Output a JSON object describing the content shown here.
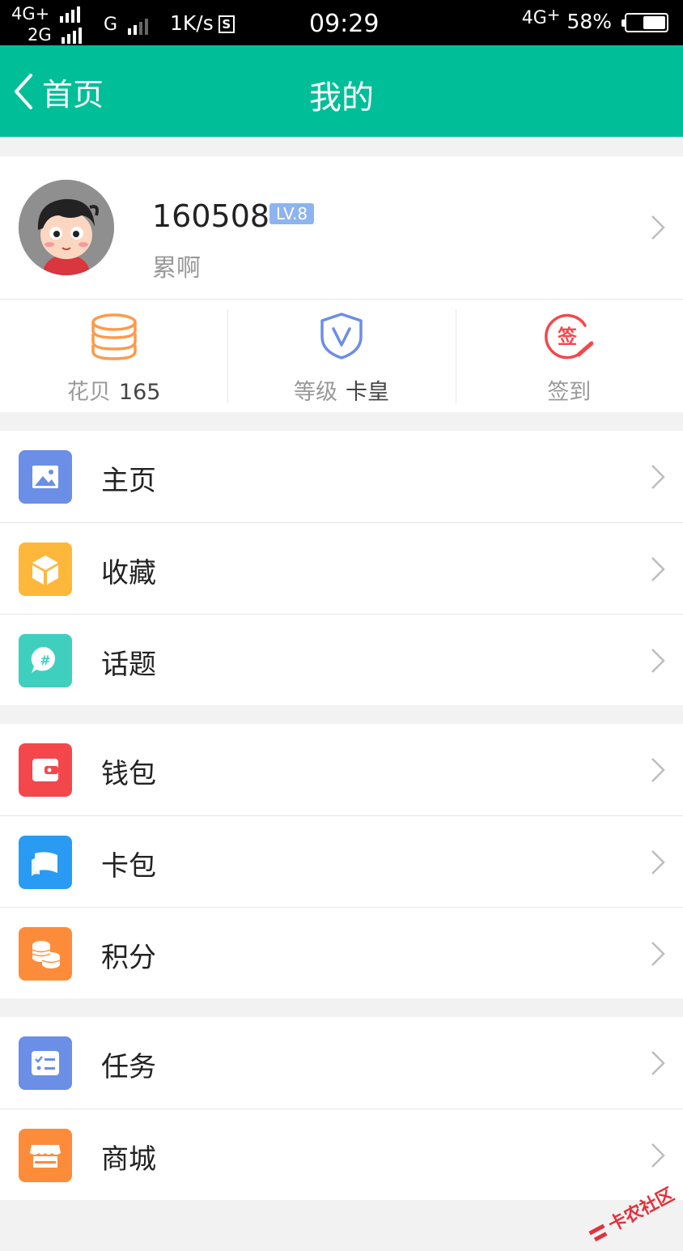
{
  "status_bar": {
    "net1": "4G+",
    "net2": "2G",
    "net3": "G",
    "speed": "1K/s",
    "sim_icon": "S",
    "time": "09:29",
    "net4": "4G",
    "battery": "58%",
    "battery_level": 0.58
  },
  "header": {
    "back_label": "首页",
    "title": "我的",
    "color": "#00bf98"
  },
  "profile": {
    "username": "160508",
    "level_badge": "LV.8",
    "signature": "累啊"
  },
  "stats": [
    {
      "label": "花贝",
      "value": "165",
      "icon": "coins-stack-icon"
    },
    {
      "label": "等级",
      "value": "卡皇",
      "icon": "shield-v-icon"
    },
    {
      "label": "签到",
      "value": "",
      "icon": "checkin-stamp-icon"
    }
  ],
  "menu": {
    "group1": [
      {
        "label": "主页",
        "icon": "image-icon",
        "color": "#6b8ee6"
      },
      {
        "label": "收藏",
        "icon": "box-icon",
        "color": "#fdb73a"
      },
      {
        "label": "话题",
        "icon": "hashtag-chat-icon",
        "color": "#3fcfbf"
      }
    ],
    "group2": [
      {
        "label": "钱包",
        "icon": "wallet-icon",
        "color": "#f4474c"
      },
      {
        "label": "卡包",
        "icon": "card-icon",
        "color": "#2a9bf2"
      },
      {
        "label": "积分",
        "icon": "coins-icon",
        "color": "#fd8c3a"
      }
    ],
    "group3": [
      {
        "label": "任务",
        "icon": "task-list-icon",
        "color": "#6b8ee6"
      },
      {
        "label": "商城",
        "icon": "shop-icon",
        "color": "#fd8c3a"
      }
    ]
  },
  "watermark": "卡农社区"
}
